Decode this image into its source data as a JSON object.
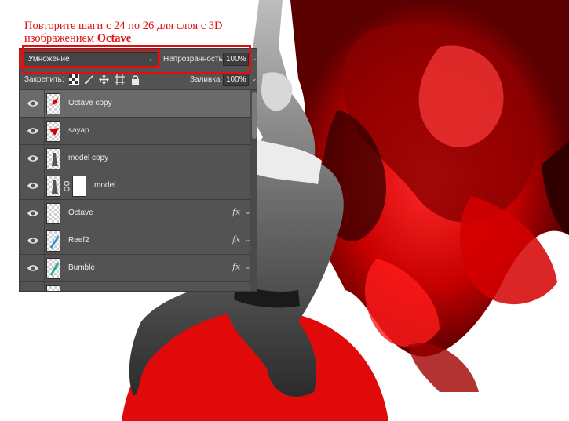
{
  "caption": {
    "line1": "Повторите шаги с 24 по 26 для слоя с 3D",
    "line2_prefix": "изображением ",
    "line2_bold": "Octave"
  },
  "panel": {
    "blend_mode": "Умножение",
    "opacity_label": "Непрозрачность:",
    "opacity_value": "100%",
    "lock_label": "Закрепить:",
    "fill_label": "Заливка:",
    "fill_value": "100%",
    "layers": [
      {
        "name": "Octave copy",
        "selected": true,
        "fx": false,
        "mask": false
      },
      {
        "name": "sayap",
        "selected": false,
        "fx": false,
        "mask": false
      },
      {
        "name": "model copy",
        "selected": false,
        "fx": false,
        "mask": false
      },
      {
        "name": "model",
        "selected": false,
        "fx": false,
        "mask": true
      },
      {
        "name": "Octave",
        "selected": false,
        "fx": true,
        "fx_label": "fx",
        "mask": false
      },
      {
        "name": "Reef2",
        "selected": false,
        "fx": true,
        "fx_label": "fx",
        "mask": false
      },
      {
        "name": "Bumble",
        "selected": false,
        "fx": true,
        "fx_label": "fx",
        "mask": false
      }
    ]
  },
  "colors": {
    "accent_red": "#e50d0d",
    "panel_bg": "#535353",
    "selected_row": "#6a6a6a"
  }
}
